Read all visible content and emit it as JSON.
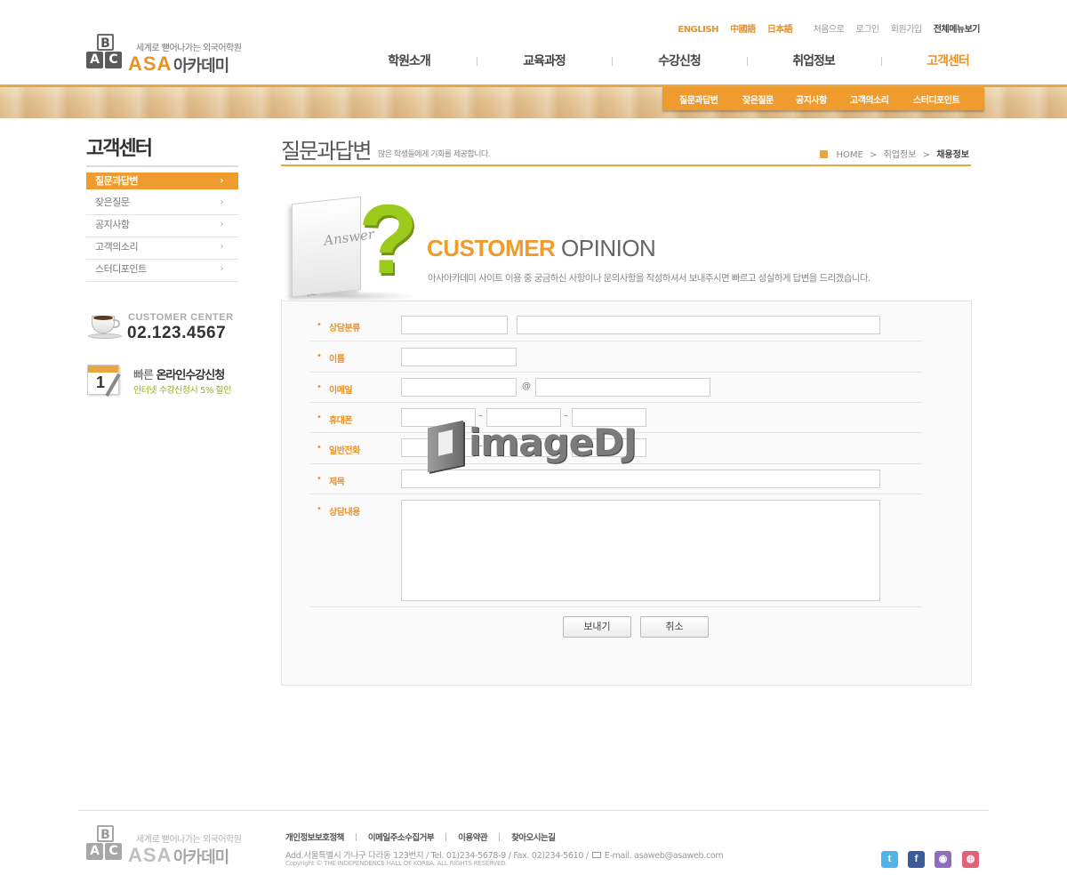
{
  "header": {
    "logo": {
      "b": "B",
      "a": "A",
      "c": "C",
      "slogan": "세계로 뻗어나가는 외국어학원",
      "asa": "ASA",
      "name": "아카데미"
    },
    "top_links": {
      "english": "ENGLISH",
      "chinese": "中國語",
      "japanese": "日本語",
      "home": "처음으로",
      "login": "로그인",
      "join": "회원가입",
      "all_menu": "전체메뉴보기"
    },
    "gnb": [
      "학원소개",
      "교육과정",
      "수강신청",
      "취업정보",
      "고객센터"
    ],
    "subnav": [
      "질문과답변",
      "잦은질문",
      "공지사항",
      "고객의소리",
      "스터디포인트"
    ]
  },
  "sidebar": {
    "title": "고객센터",
    "items": [
      {
        "label": "질문과답변",
        "active": true
      },
      {
        "label": "잦은질문",
        "active": false
      },
      {
        "label": "공지사항",
        "active": false
      },
      {
        "label": "고객의소리",
        "active": false
      },
      {
        "label": "스터디포인트",
        "active": false
      }
    ],
    "arrow": "›",
    "customer_center": {
      "label": "CUSTOMER CENTER",
      "phone": "02.123.4567"
    },
    "online": {
      "title_light": "빠른",
      "title_bold": "온라인수강신청",
      "sub": "인터넷 수강신청시 5% 할인"
    }
  },
  "content": {
    "title": "질문과답변",
    "subtitle": "많은 학생들에게 기회를 제공합니다.",
    "breadcrumb": {
      "home": "HOME",
      "mid": "취업정보",
      "current": "채용정보",
      "sep": ">"
    },
    "illustration_word": "Answer",
    "illustration_mark": "?",
    "opinion_title_bold": "CUSTOMER",
    "opinion_title_light": "OPINION",
    "opinion_desc": "아사아카데미 사이트 이용 중 궁금하신 사항이나 문의사항을 작성하셔서 보내주시면 빠르고 성실하게 답변을 드리겠습니다."
  },
  "form": {
    "bullet": "•",
    "labels": {
      "category": "상담분류",
      "name": "이름",
      "email": "이메일",
      "mobile": "휴대폰",
      "phone": "일반전화",
      "subject": "제목",
      "content": "상담내용"
    },
    "at": "@",
    "dash": "–",
    "buttons": {
      "send": "보내기",
      "cancel": "취소"
    }
  },
  "watermark": "imageDJ",
  "footer": {
    "links": [
      "개인정보보호정책",
      "이메일주소수집거부",
      "이용약관",
      "찾아오시는길"
    ],
    "address": "Add.서울특별시 가나구 다라동 123번지  /  Tel. 01)234-5678-9  /  Fax. 02)234-5610  /",
    "email": "E-mail. asaweb@asaweb.com",
    "copyright": "Copyright © THE INDEPENDENCE HALL OF KOREA. ALL RIGHTS RESERVED.",
    "sns": [
      {
        "name": "twitter-icon",
        "glyph": "t",
        "color": "#4fb5e8"
      },
      {
        "name": "facebook-icon",
        "glyph": "f",
        "color": "#3b5a9a"
      },
      {
        "name": "me2day-icon",
        "glyph": "◉",
        "color": "#8e6cc0"
      },
      {
        "name": "yozm-icon",
        "glyph": "◍",
        "color": "#e0627a"
      }
    ]
  }
}
